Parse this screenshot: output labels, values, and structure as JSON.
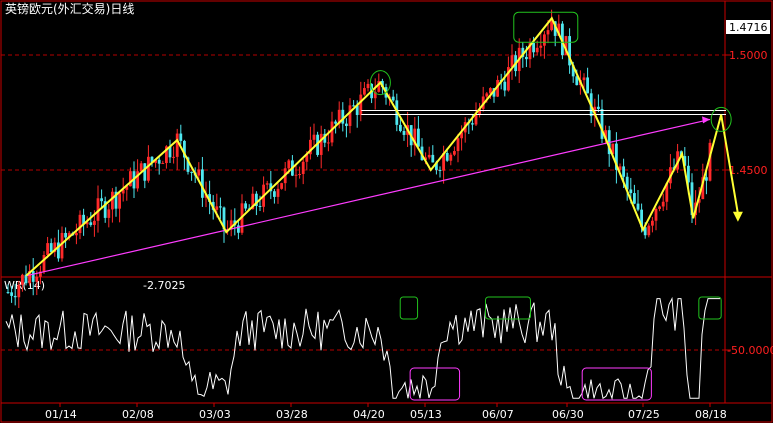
{
  "title": "英镑欧元(外汇交易)日线",
  "price_axis": {
    "current_price": "1.4716",
    "ticks": [
      "1.5000",
      "1.4500"
    ]
  },
  "indicator": {
    "name": "WR(14)",
    "value": "-2.7025",
    "tick": "-50.0000"
  },
  "colors": {
    "up": "#ff2a2a",
    "down": "#4fe8f0",
    "trend": "#ffff33",
    "support": "#ff3cff",
    "resistance": "#ffffff",
    "highlight_green": "#22c21e",
    "highlight_magenta": "#ff3cff",
    "frame": "#c80000"
  },
  "chart_data": [
    {
      "type": "candlestick",
      "x_ticks": [
        "01/14",
        "02/08",
        "03/03",
        "03/28",
        "04/20",
        "05/13",
        "06/07",
        "06/30",
        "07/25",
        "08/18"
      ],
      "y_ticks": [
        1.5,
        1.45
      ],
      "ylim": [
        1.4,
        1.518
      ],
      "last_price": 1.4716,
      "trend_line": [
        {
          "x": "01/03",
          "y": 1.404
        },
        {
          "x": "02/20",
          "y": 1.463
        },
        {
          "x": "03/07",
          "y": 1.423
        },
        {
          "x": "04/25",
          "y": 1.488
        },
        {
          "x": "05/15",
          "y": 1.45
        },
        {
          "x": "06/25",
          "y": 1.516
        },
        {
          "x": "07/12",
          "y": 1.466
        },
        {
          "x": "07/25",
          "y": 1.424
        },
        {
          "x": "08/08",
          "y": 1.457
        },
        {
          "x": "08/12",
          "y": 1.429
        },
        {
          "x": "08/22",
          "y": 1.474
        },
        {
          "x": "08/28",
          "y": 1.431
        }
      ],
      "support_line": [
        {
          "x": "01/03",
          "y": 1.404
        },
        {
          "x": "08/18",
          "y": 1.472
        }
      ],
      "resistance_level": 1.475,
      "highlights": [
        {
          "x": "04/25",
          "y": 1.488,
          "shape": "circle"
        },
        {
          "x": "06/25",
          "y": 1.516,
          "shape": "box"
        },
        {
          "x": "08/22",
          "y": 1.472,
          "shape": "circle"
        }
      ]
    },
    {
      "type": "line",
      "name": "WR(14)",
      "ylim": [
        0,
        100
      ],
      "y_ticks": [
        -50
      ],
      "last_value": -2.7025,
      "overbought_boxes": [
        {
          "from": "05/03",
          "to": "05/10"
        },
        {
          "from": "06/03",
          "to": "06/18"
        },
        {
          "from": "08/14",
          "to": "08/22"
        }
      ],
      "oversold_boxes": [
        {
          "from": "05/07",
          "to": "05/25"
        },
        {
          "from": "07/05",
          "to": "07/28"
        }
      ]
    }
  ]
}
